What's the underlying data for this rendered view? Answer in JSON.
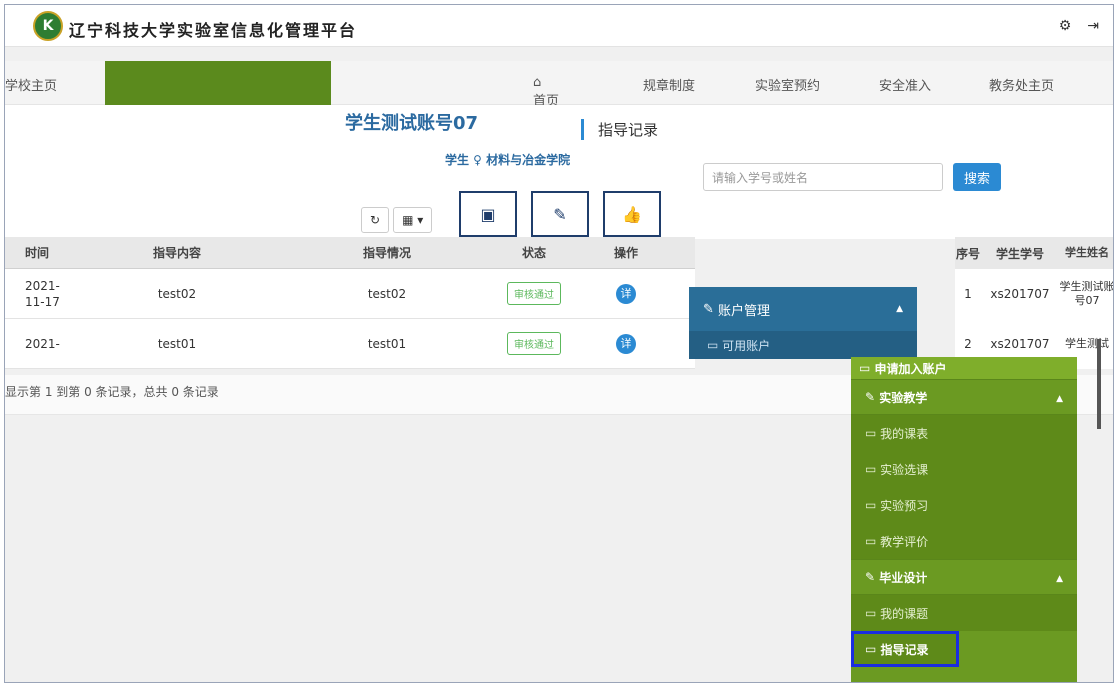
{
  "header": {
    "logo_text": "K",
    "title": "辽宁科技大学实验室信息化管理平台",
    "icons": [
      "gear-icon",
      "logout-icon"
    ]
  },
  "nav": {
    "left_label": "学校主页",
    "items": [
      "首页",
      "规章制度",
      "实验室预约",
      "安全准入",
      "教务处主页"
    ],
    "home_icon": "home-icon"
  },
  "page": {
    "username": "学生测试账号07",
    "title": "指导记录",
    "meta": "学生 ♀ 材料与冶金学院"
  },
  "search": {
    "placeholder": "请输入学号或姓名",
    "button": "搜索"
  },
  "toolbar": {
    "refresh_icon": "refresh-icon",
    "columns_icon": "columns-icon"
  },
  "table": {
    "headers": [
      "时间",
      "指导内容",
      "指导情况",
      "状态",
      "操作"
    ],
    "rows": [
      {
        "time": "2021-11-17",
        "content": "test02",
        "situation": "test02",
        "status": "审核通过",
        "action": "详"
      },
      {
        "time": "2021-",
        "content": "test01",
        "situation": "test01",
        "status": "审核通过",
        "action": "详"
      }
    ]
  },
  "right_table": {
    "headers": [
      "序号",
      "学生学号",
      "学生姓名"
    ],
    "rows": [
      {
        "idx": "1",
        "sno": "xs201707",
        "name": "学生测试账号07"
      },
      {
        "idx": "2",
        "sno": "xs201707",
        "name": "学生测试"
      }
    ]
  },
  "summary": "显示第 1 到第 0 条记录，总共 0 条记录",
  "account_panel": {
    "title": "账户管理",
    "sub": "可用账户"
  },
  "sidebar": {
    "top_item": "申请加入账户",
    "sections": [
      {
        "title": "实验教学",
        "items": [
          "我的课表",
          "实验选课",
          "实验预习",
          "教学评价"
        ]
      },
      {
        "title": "毕业设计",
        "items": [
          "我的课题",
          "指导记录"
        ]
      }
    ]
  }
}
